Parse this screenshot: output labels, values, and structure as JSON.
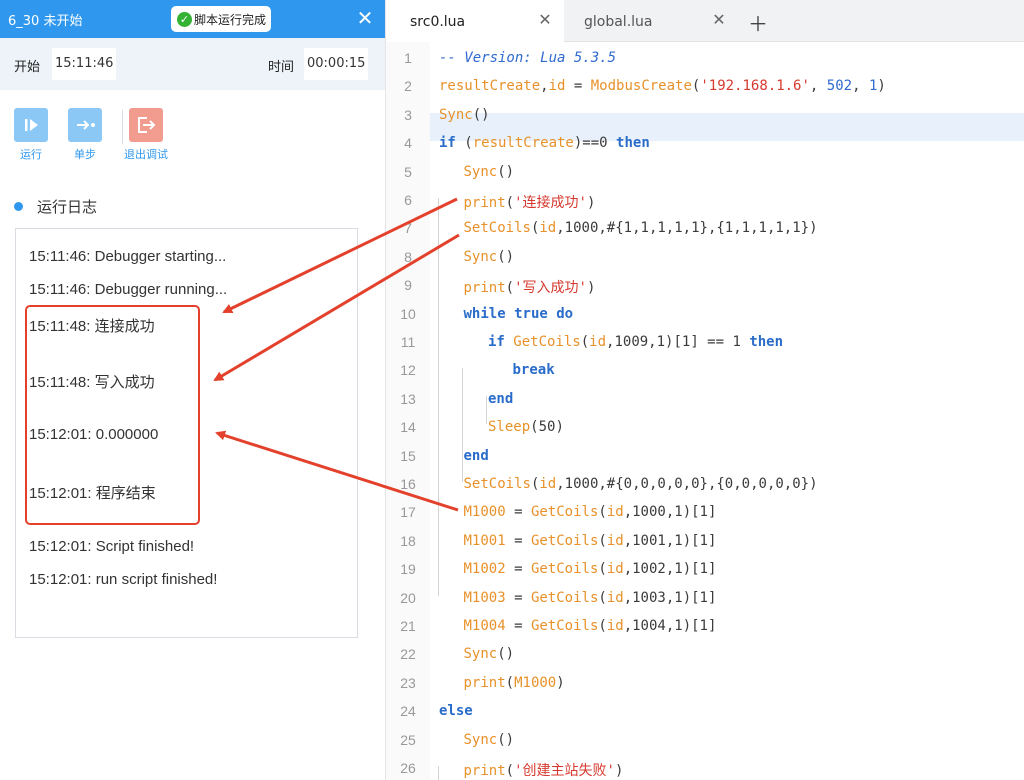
{
  "debug_panel": {
    "title": "6_30 未开始",
    "status_badge": "脚本运行完成",
    "start_label": "开始",
    "start_time": "15:11:46",
    "duration_label": "时间",
    "duration": "00:00:15",
    "toolbar": {
      "run": "运行",
      "step": "单步",
      "exit": "退出调试"
    },
    "log_title": "运行日志",
    "log": [
      "15:11:46: Debugger starting...",
      "15:11:46: Debugger running...",
      "15:11:48: 连接成功",
      "15:11:48: 写入成功",
      "15:12:01: 0.000000",
      "15:12:01: 程序结束",
      "15:12:01: Script finished!",
      "15:12:01: run script finished!"
    ]
  },
  "editor": {
    "tabs": [
      {
        "label": "src0.lua",
        "active": true
      },
      {
        "label": "global.lua",
        "active": false
      }
    ],
    "line_numbers": [
      "1",
      "2",
      "3",
      "4",
      "5",
      "6",
      "7",
      "8",
      "9",
      "10",
      "11",
      "12",
      "13",
      "14",
      "15",
      "16",
      "17",
      "18",
      "19",
      "20",
      "21",
      "22",
      "23",
      "24",
      "25",
      "26"
    ],
    "code": [
      [
        [
          "cm",
          "-- Version: Lua 5.3.5"
        ]
      ],
      [
        [
          "va",
          "resultCreate"
        ],
        [
          "pl",
          ","
        ],
        [
          "va",
          "id"
        ],
        [
          "pl",
          " = "
        ],
        [
          "fn",
          "ModbusCreate"
        ],
        [
          "pl",
          "("
        ],
        [
          "st",
          "'192.168.1.6'"
        ],
        [
          "pl",
          ", "
        ],
        [
          "nm",
          "502"
        ],
        [
          "pl",
          ", "
        ],
        [
          "nm",
          "1"
        ],
        [
          "pl",
          ")"
        ]
      ],
      [
        [
          "fn",
          "Sync"
        ],
        [
          "pl",
          "()"
        ]
      ],
      [
        [
          "kw",
          "if"
        ],
        [
          "pl",
          " ("
        ],
        [
          "va",
          "resultCreate"
        ],
        [
          "pl",
          ")==0 "
        ],
        [
          "kw",
          "then"
        ]
      ],
      [
        [
          "fn",
          "Sync"
        ],
        [
          "pl",
          "()"
        ]
      ],
      [
        [
          "fn",
          "print"
        ],
        [
          "pl",
          "("
        ],
        [
          "st",
          "'连接成功'"
        ],
        [
          "pl",
          ")"
        ]
      ],
      [
        [
          "fn",
          "SetCoils"
        ],
        [
          "pl",
          "("
        ],
        [
          "va",
          "id"
        ],
        [
          "pl",
          ",1000,#{1,1,1,1,1},{1,1,1,1,1})"
        ]
      ],
      [
        [
          "fn",
          "Sync"
        ],
        [
          "pl",
          "()"
        ]
      ],
      [
        [
          "fn",
          "print"
        ],
        [
          "pl",
          "("
        ],
        [
          "st",
          "'写入成功'"
        ],
        [
          "pl",
          ")"
        ]
      ],
      [
        [
          "kw",
          "while"
        ],
        [
          "pl",
          " "
        ],
        [
          "kw",
          "true"
        ],
        [
          "pl",
          " "
        ],
        [
          "kw",
          "do"
        ]
      ],
      [
        [
          "kw",
          "if"
        ],
        [
          "pl",
          " "
        ],
        [
          "fn",
          "GetCoils"
        ],
        [
          "pl",
          "("
        ],
        [
          "va",
          "id"
        ],
        [
          "pl",
          ",1009,1)[1] == 1 "
        ],
        [
          "kw",
          "then"
        ]
      ],
      [
        [
          "kw",
          "break"
        ]
      ],
      [
        [
          "kw",
          "end"
        ]
      ],
      [
        [
          "fn",
          "Sleep"
        ],
        [
          "pl",
          "(50)"
        ]
      ],
      [
        [
          "kw",
          "end"
        ]
      ],
      [
        [
          "fn",
          "SetCoils"
        ],
        [
          "pl",
          "("
        ],
        [
          "va",
          "id"
        ],
        [
          "pl",
          ",1000,#{0,0,0,0,0},{0,0,0,0,0})"
        ]
      ],
      [
        [
          "va",
          "M1000"
        ],
        [
          "pl",
          " = "
        ],
        [
          "fn",
          "GetCoils"
        ],
        [
          "pl",
          "("
        ],
        [
          "va",
          "id"
        ],
        [
          "pl",
          ",1000,1)[1]"
        ]
      ],
      [
        [
          "va",
          "M1001"
        ],
        [
          "pl",
          " = "
        ],
        [
          "fn",
          "GetCoils"
        ],
        [
          "pl",
          "("
        ],
        [
          "va",
          "id"
        ],
        [
          "pl",
          ",1001,1)[1]"
        ]
      ],
      [
        [
          "va",
          "M1002"
        ],
        [
          "pl",
          " = "
        ],
        [
          "fn",
          "GetCoils"
        ],
        [
          "pl",
          "("
        ],
        [
          "va",
          "id"
        ],
        [
          "pl",
          ",1002,1)[1]"
        ]
      ],
      [
        [
          "va",
          "M1003"
        ],
        [
          "pl",
          " = "
        ],
        [
          "fn",
          "GetCoils"
        ],
        [
          "pl",
          "("
        ],
        [
          "va",
          "id"
        ],
        [
          "pl",
          ",1003,1)[1]"
        ]
      ],
      [
        [
          "va",
          "M1004"
        ],
        [
          "pl",
          " = "
        ],
        [
          "fn",
          "GetCoils"
        ],
        [
          "pl",
          "("
        ],
        [
          "va",
          "id"
        ],
        [
          "pl",
          ",1004,1)[1]"
        ]
      ],
      [
        [
          "fn",
          "Sync"
        ],
        [
          "pl",
          "()"
        ]
      ],
      [
        [
          "fn",
          "print"
        ],
        [
          "pl",
          "("
        ],
        [
          "va",
          "M1000"
        ],
        [
          "pl",
          ")"
        ]
      ],
      [
        [
          "kw",
          "else"
        ]
      ],
      [
        [
          "fn",
          "Sync"
        ],
        [
          "pl",
          "()"
        ]
      ],
      [
        [
          "fn",
          "print"
        ],
        [
          "pl",
          "("
        ],
        [
          "st",
          "'创建主站失败'"
        ],
        [
          "pl",
          ")"
        ]
      ]
    ]
  },
  "colors": {
    "accent": "#2f98ee",
    "callout": "#e3412c",
    "keyword": "#2a6cc9",
    "function": "#e8912a",
    "string": "#d63a2f"
  }
}
